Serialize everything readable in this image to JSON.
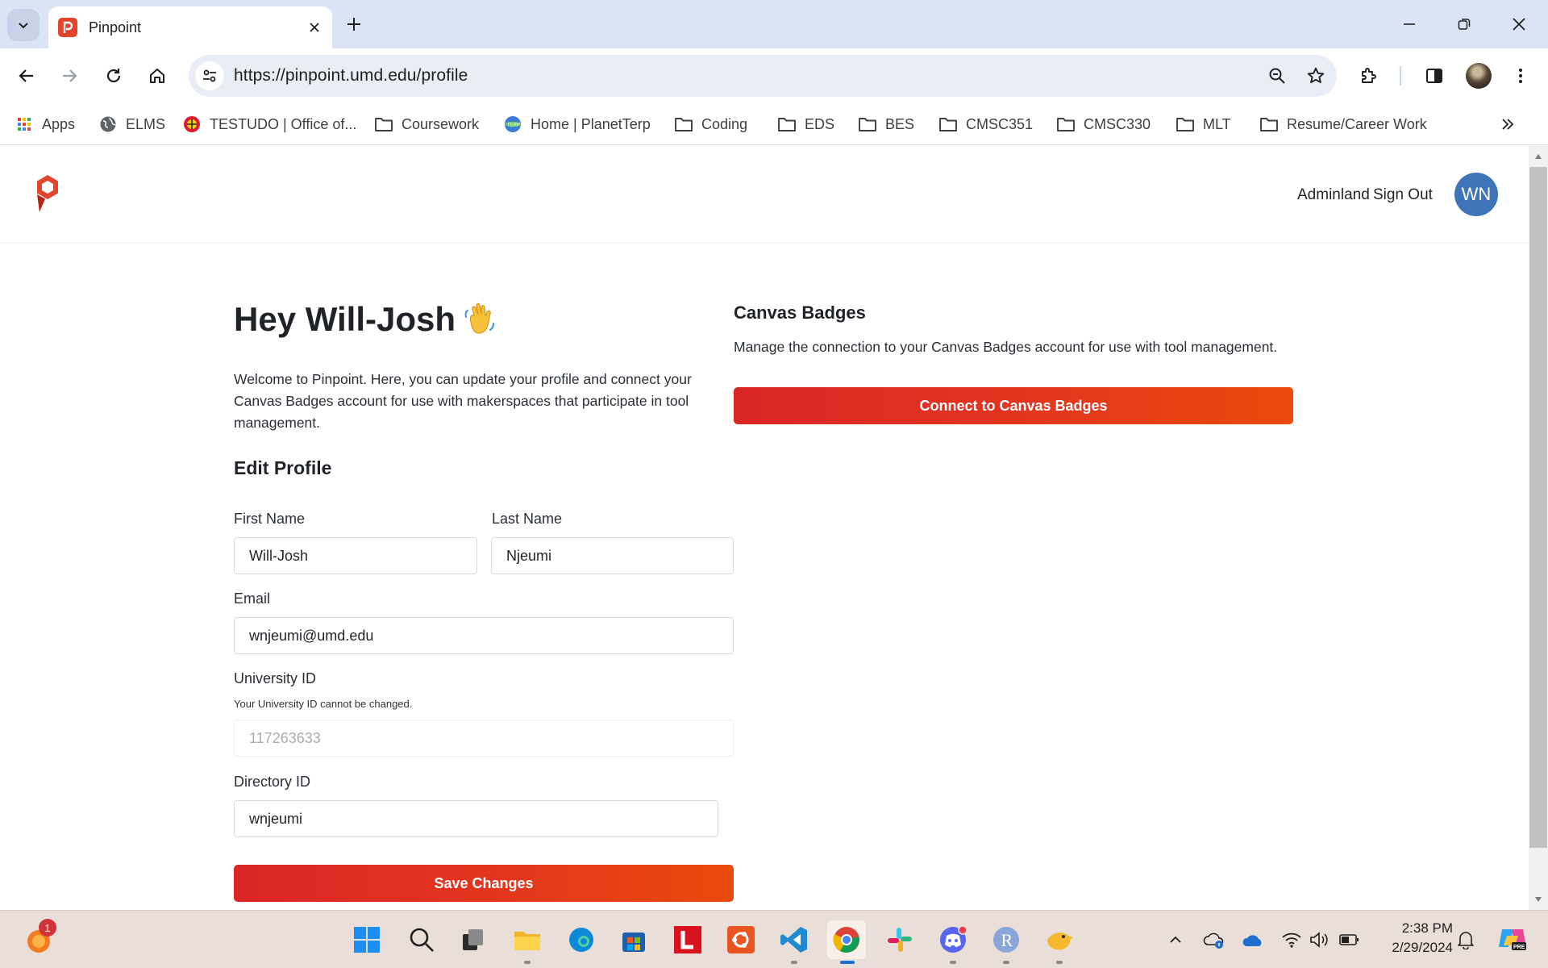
{
  "browser": {
    "tab_title": "Pinpoint",
    "url": "https://pinpoint.umd.edu/profile",
    "bookmarks": [
      {
        "label": "Apps",
        "icon": "apps-grid-icon"
      },
      {
        "label": "ELMS",
        "icon": "globe-icon"
      },
      {
        "label": "TESTUDO | Office of...",
        "icon": "umd-seal-icon"
      },
      {
        "label": "Coursework",
        "icon": "folder-icon"
      },
      {
        "label": "Home | PlanetTerp",
        "icon": "planetterp-icon"
      },
      {
        "label": "Coding",
        "icon": "folder-icon"
      },
      {
        "label": "EDS",
        "icon": "folder-icon"
      },
      {
        "label": "BES",
        "icon": "folder-icon"
      },
      {
        "label": "CMSC351",
        "icon": "folder-icon"
      },
      {
        "label": "CMSC330",
        "icon": "folder-icon"
      },
      {
        "label": "MLT",
        "icon": "folder-icon"
      },
      {
        "label": "Resume/Career Work",
        "icon": "folder-icon"
      }
    ]
  },
  "header": {
    "adminland": "Adminland",
    "sign_out": "Sign Out",
    "avatar_initials": "WN"
  },
  "profile": {
    "greeting": "Hey Will-Josh",
    "intro": "Welcome to Pinpoint. Here, you can update your profile and connect your Canvas Badges account for use with makerspaces that participate in tool management.",
    "edit_heading": "Edit Profile",
    "first_name_label": "First Name",
    "first_name": "Will-Josh",
    "last_name_label": "Last Name",
    "last_name": "Njeumi",
    "email_label": "Email",
    "email": "wnjeumi@umd.edu",
    "uid_label": "University ID",
    "uid_help": "Your University ID cannot be changed.",
    "uid": "117263633",
    "directory_label": "Directory ID",
    "directory": "wnjeumi",
    "save_label": "Save Changes"
  },
  "badges": {
    "heading": "Canvas Badges",
    "description": "Manage the connection to your Canvas Badges account for use with tool management.",
    "connect_label": "Connect to Canvas Badges"
  },
  "taskbar": {
    "notification_count": "1",
    "time": "2:38 PM",
    "date": "2/29/2024"
  },
  "colors": {
    "brand_red": "#dc2626",
    "brand_orange": "#ea4a0c",
    "avatar_blue": "#3f75b8"
  }
}
